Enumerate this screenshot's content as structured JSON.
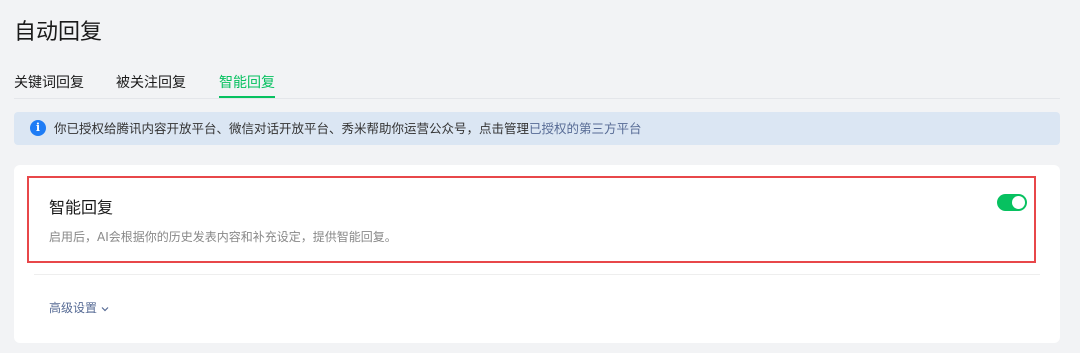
{
  "page": {
    "title": "自动回复"
  },
  "tabs": [
    {
      "label": "关键词回复",
      "active": false
    },
    {
      "label": "被关注回复",
      "active": false
    },
    {
      "label": "智能回复",
      "active": true
    }
  ],
  "notice": {
    "icon": "info-icon",
    "icon_glyph": "i",
    "text": "你已授权给腾讯内容开放平台、微信对话开放平台、秀米帮助你运营公众号，点击管理",
    "link_text": "已授权的第三方平台"
  },
  "smart_reply": {
    "title": "智能回复",
    "description": "启用后，AI会根据你的历史发表内容和补充设定，提供智能回复。",
    "enabled": true
  },
  "advanced": {
    "label": "高级设置"
  },
  "colors": {
    "accent": "#07c160",
    "link": "#576b95",
    "info": "#1e7cf5",
    "highlight_border": "#e8474a",
    "notice_bg": "#dbe6f3"
  }
}
